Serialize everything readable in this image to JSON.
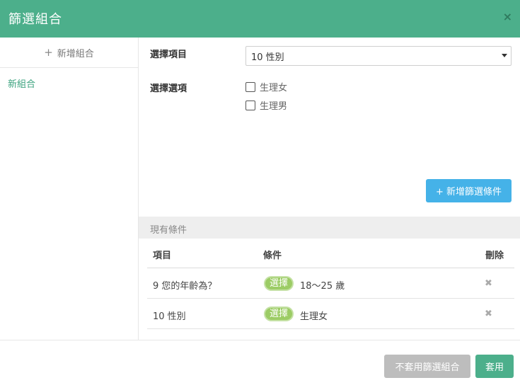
{
  "dialog": {
    "title": "篩選組合",
    "close_icon": "×"
  },
  "sidebar": {
    "add_icon": "+",
    "add_label": "新增組合",
    "groups": [
      {
        "label": "新組合"
      }
    ]
  },
  "form": {
    "item_label": "選擇項目",
    "item_value": "10 性別",
    "options_label": "選擇選項",
    "options": [
      {
        "label": "生理女",
        "checked": false
      },
      {
        "label": "生理男",
        "checked": false
      }
    ],
    "add_condition_label": "+ 新增篩選條件"
  },
  "existing": {
    "title": "現有條件",
    "headers": {
      "item": "項目",
      "condition": "條件",
      "delete": "刪除"
    },
    "rows": [
      {
        "item": "9 您的年齡為？",
        "tag": "選擇",
        "value": "18～25 歲",
        "delete_icon": "✖"
      },
      {
        "item": "10 性別",
        "tag": "選擇",
        "value": "生理女",
        "delete_icon": "✖"
      }
    ]
  },
  "footer": {
    "cancel_label": "不套用篩選組合",
    "apply_label": "套用"
  },
  "colors": {
    "header": "#4caf8b",
    "accent": "#3da37f",
    "primary_button": "#45b2e8",
    "tag": "#9ccc65",
    "disabled_button": "#bdbdbd"
  }
}
